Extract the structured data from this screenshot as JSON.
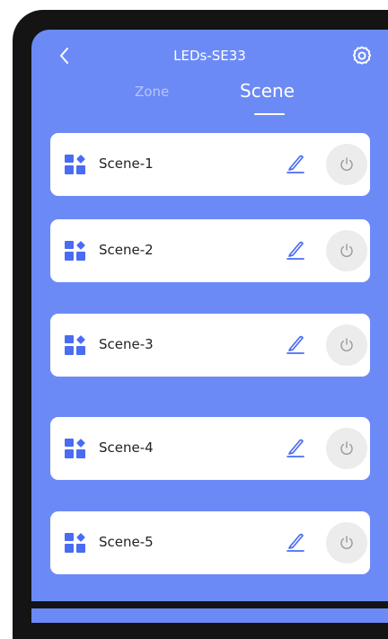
{
  "header": {
    "title": "LEDs-SE33",
    "back_icon": "chevron-left-icon",
    "settings_icon": "gear-icon"
  },
  "tabs": [
    {
      "label": "Zone",
      "active": false
    },
    {
      "label": "Scene",
      "active": true
    }
  ],
  "scenes": [
    {
      "label": "Scene-1"
    },
    {
      "label": "Scene-2"
    },
    {
      "label": "Scene-3"
    },
    {
      "label": "Scene-4"
    },
    {
      "label": "Scene-5"
    }
  ],
  "colors": {
    "background": "#6c8af6",
    "accent": "#4a6cf2",
    "card": "#ffffff",
    "power_button": "#ececec"
  }
}
